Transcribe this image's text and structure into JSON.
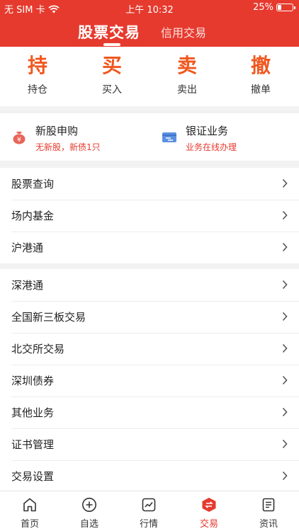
{
  "status_bar": {
    "carrier": "无 SIM 卡",
    "time": "上午 10:32",
    "battery_percent": "25%",
    "battery_level": 0.25
  },
  "header": {
    "tab_active": "股票交易",
    "tab_other": "信用交易"
  },
  "quick_actions": [
    {
      "char": "持",
      "label": "持仓"
    },
    {
      "char": "买",
      "label": "买入"
    },
    {
      "char": "卖",
      "label": "卖出"
    },
    {
      "char": "撤",
      "label": "撤单"
    }
  ],
  "services": [
    {
      "icon": "money-bag-icon",
      "title": "新股申购",
      "subtitle": "无新股，新债1只"
    },
    {
      "icon": "bank-card-icon",
      "title": "银证业务",
      "subtitle": "业务在线办理"
    }
  ],
  "menu_group_1": [
    {
      "label": "股票查询"
    },
    {
      "label": "场内基金"
    },
    {
      "label": "沪港通"
    }
  ],
  "menu_group_2": [
    {
      "label": "深港通"
    },
    {
      "label": "全国新三板交易"
    },
    {
      "label": "北交所交易"
    },
    {
      "label": "深圳债券"
    },
    {
      "label": "其他业务"
    },
    {
      "label": "证书管理"
    },
    {
      "label": "交易设置"
    }
  ],
  "bottom_nav": [
    {
      "icon": "home-icon",
      "label": "首页"
    },
    {
      "icon": "add-circle-icon",
      "label": "自选"
    },
    {
      "icon": "chart-icon",
      "label": "行情"
    },
    {
      "icon": "trade-icon",
      "label": "交易",
      "active": true
    },
    {
      "icon": "news-icon",
      "label": "资讯"
    }
  ],
  "colors": {
    "brand_red": "#e63a2e",
    "action_orange": "#f0571e",
    "background": "#f2f2f2"
  }
}
